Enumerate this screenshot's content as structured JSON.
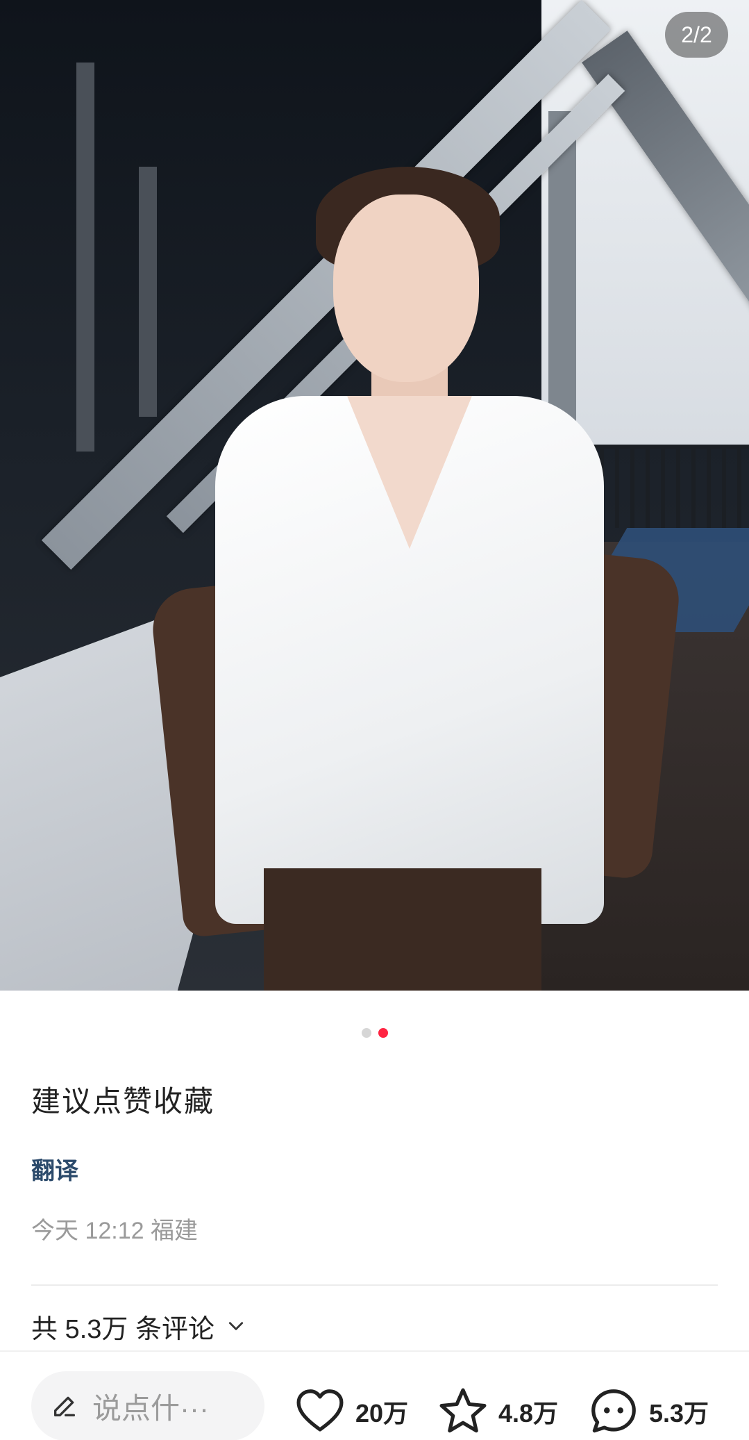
{
  "photo": {
    "page_indicator": "2/2",
    "carousel": {
      "total": 2,
      "active_index": 1
    }
  },
  "note": {
    "title": "建议点赞收藏",
    "translate_label": "翻译",
    "meta": "今天 12:12 福建"
  },
  "comments": {
    "summary": "共 5.3万 条评论"
  },
  "bottom_bar": {
    "input_placeholder": "说点什···",
    "like_count": "20万",
    "favorite_count": "4.8万",
    "comment_count": "5.3万"
  },
  "colors": {
    "accent": "#ff2442",
    "link": "#2b4a6b"
  }
}
